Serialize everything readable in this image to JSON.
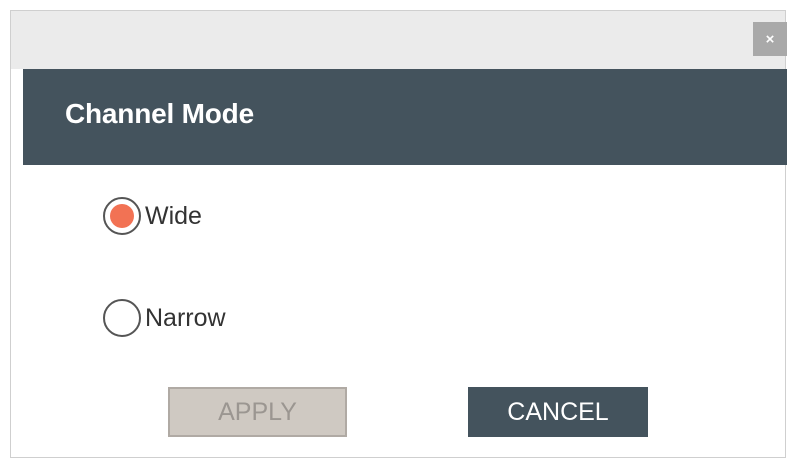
{
  "dialog": {
    "close_label": "×",
    "title": "Channel Mode",
    "options": [
      {
        "label": "Wide",
        "selected": true
      },
      {
        "label": "Narrow",
        "selected": false
      }
    ],
    "apply_label": "APPLY",
    "cancel_label": "CANCEL"
  },
  "colors": {
    "header_bg": "#44535d",
    "radio_selected": "#f27254",
    "apply_disabled_bg": "#cfc9c2",
    "cancel_bg": "#44535d"
  }
}
